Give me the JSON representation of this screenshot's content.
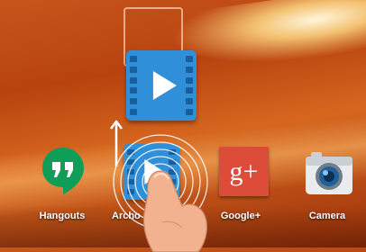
{
  "wallpaper": {
    "accent": "#c8551c"
  },
  "apps": [
    {
      "label": "Hangouts",
      "icon": "hangouts-icon",
      "color": "#0f9d58"
    },
    {
      "label": "Archo",
      "icon": "video-player-icon",
      "color": "#2f8fd8"
    },
    {
      "label": "Google+",
      "icon": "google-plus-icon",
      "color": "#dd4b39",
      "glyph": "g+"
    },
    {
      "label": "Camera",
      "icon": "camera-icon",
      "color": "#7a8a96"
    }
  ],
  "drag": {
    "icon": "video-player-icon",
    "gesture": "drag-up"
  }
}
